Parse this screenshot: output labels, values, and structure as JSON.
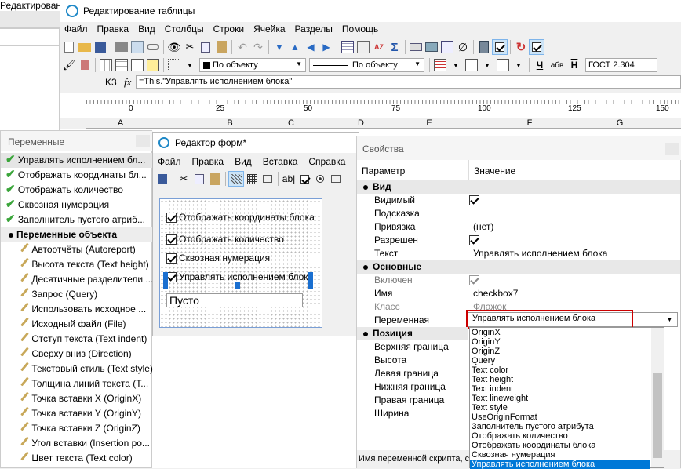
{
  "table_window": {
    "partial_title": "Редактирован",
    "title": "Редактирование таблицы",
    "menu": [
      "Файл",
      "Правка",
      "Вид",
      "Столбцы",
      "Строки",
      "Ячейка",
      "Разделы",
      "Помощь"
    ],
    "fill_select": "По объекту",
    "line_select": "По объекту",
    "bold_a": "Ч",
    "abc": "абв",
    "h_bar": "Н",
    "standard": "ГОСТ 2.304",
    "cell_ref": "K3",
    "fx": "fx",
    "formula": "=This.\"Управлять исполнением блока\"",
    "ruler": [
      "0",
      "25",
      "50",
      "75",
      "100",
      "125",
      "150"
    ],
    "columns": [
      "A",
      "B",
      "C",
      "D",
      "E",
      "F",
      "G"
    ]
  },
  "variables": {
    "title": "Переменные",
    "items": [
      "Управлять исполнением бл...",
      "Отображать координаты бл...",
      "Отображать количество",
      "Сквозная нумерация",
      "Заполнитель пустого атриб..."
    ],
    "group": "Переменные объекта",
    "object_items": [
      "Автоотчёты (Autoreport)",
      "Высота текста (Text height)",
      "Десятичные разделители ...",
      "Запрос (Query)",
      "Использовать исходное ...",
      "Исходный файл (File)",
      "Отступ текста (Text indent)",
      "Сверху вниз (Direction)",
      "Текстовый стиль (Text style)",
      "Толщина линий текста (Т...",
      "Точка вставки X (OriginX)",
      "Точка вставки Y (OriginY)",
      "Точка вставки Z (OriginZ)",
      "Угол вставки (Insertion po...",
      "Цвет текста (Text color)"
    ]
  },
  "form_editor": {
    "title": "Редактор форм*",
    "menu": [
      "Файл",
      "Правка",
      "Вид",
      "Вставка",
      "Справка"
    ],
    "checkboxes": [
      "Отображать координаты блока",
      "Отображать количество",
      "Сквозная нумерация",
      "Управлять исполнением блока"
    ],
    "text_field": "Пусто"
  },
  "properties": {
    "title": "Свойства",
    "col_param": "Параметр",
    "col_value": "Значение",
    "sec_view": "Вид",
    "sec_basic": "Основные",
    "sec_pos": "Позиция",
    "view_rows": [
      {
        "k": "Видимый",
        "v": ""
      },
      {
        "k": "Подсказка",
        "v": ""
      },
      {
        "k": "Привязка",
        "v": "(нет)"
      },
      {
        "k": "Разрешен",
        "v": ""
      },
      {
        "k": "Текст",
        "v": "Управлять исполнением блока"
      }
    ],
    "basic_rows": [
      {
        "k": "Включен",
        "v": ""
      },
      {
        "k": "Имя",
        "v": "checkbox7"
      },
      {
        "k": "Класс",
        "v": "Флажок"
      },
      {
        "k": "Переменная",
        "v": "Управлять исполнением блока"
      }
    ],
    "pos_rows": [
      "Верхняя граница",
      "Высота",
      "Левая граница",
      "Нижняя граница",
      "Правая граница",
      "Ширина"
    ],
    "dropdown": [
      "OriginX",
      "OriginY",
      "OriginZ",
      "Query",
      "Text color",
      "Text height",
      "Text indent",
      "Text lineweight",
      "Text style",
      "UseOriginFormat",
      "Заполнитель пустого атрибута",
      "Отображать количество",
      "Отображать координаты блока",
      "Сквозная нумерация",
      "Управлять исполнением блока"
    ],
    "status": "Имя переменной скрипта, с"
  },
  "colors": {
    "highlight": "#cc0000",
    "select": "#0078d7",
    "accent": "#cce4f7"
  }
}
